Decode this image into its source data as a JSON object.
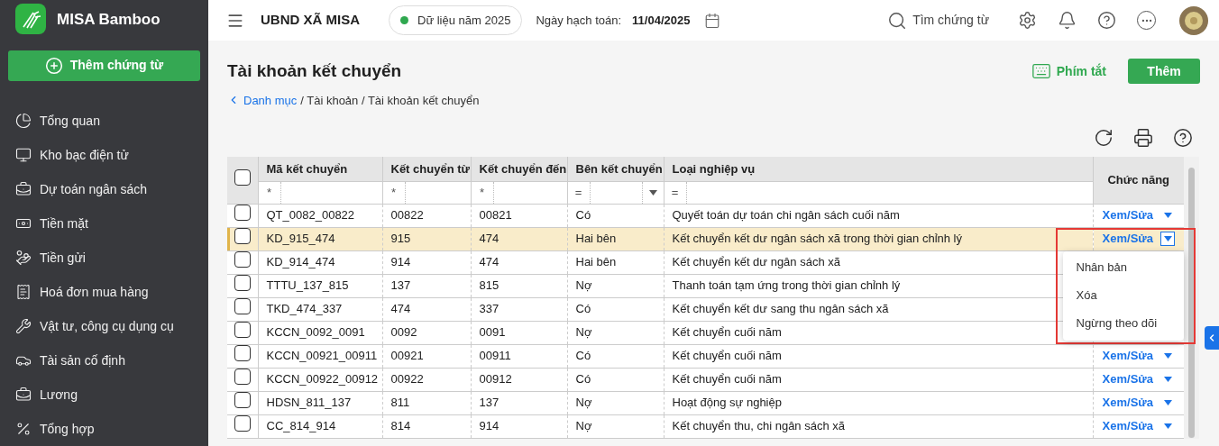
{
  "sidebar": {
    "logo": "MISA Bamboo",
    "add_button": "Thêm chứng từ",
    "items": [
      {
        "label": "Tổng quan"
      },
      {
        "label": "Kho bạc điện tử"
      },
      {
        "label": "Dự toán ngân sách"
      },
      {
        "label": "Tiền mặt"
      },
      {
        "label": "Tiền gửi"
      },
      {
        "label": "Hoá đơn mua hàng"
      },
      {
        "label": "Vật tư, công cụ dụng cụ"
      },
      {
        "label": "Tài sản cố định"
      },
      {
        "label": "Lương"
      },
      {
        "label": "Tổng hợp"
      }
    ]
  },
  "topbar": {
    "org": "UBND XÃ MISA",
    "data_year": "Dữ liệu năm 2025",
    "date_label": "Ngày hạch toán:",
    "date": "11/04/2025",
    "search": "Tìm chứng từ"
  },
  "page": {
    "title": "Tài khoản kết chuyển",
    "breadcrumb_link": "Danh mục",
    "breadcrumb_rest": "/ Tài khoản / Tài khoản kết chuyển",
    "shortcut": "Phím tắt",
    "add": "Thêm"
  },
  "table": {
    "header_checked": false,
    "columns": [
      {
        "label": "Mã kết chuyển",
        "filter_op": "*",
        "filter_dropdown": false
      },
      {
        "label": "Kết chuyển từ",
        "filter_op": "*",
        "filter_dropdown": false
      },
      {
        "label": "Kết chuyển đến",
        "filter_op": "*",
        "filter_dropdown": false
      },
      {
        "label": "Bên kết chuyển",
        "filter_op": "=",
        "filter_dropdown": true
      },
      {
        "label": "Loại nghiệp vụ",
        "filter_op": "=",
        "filter_dropdown": false
      }
    ],
    "action_column": "Chức năng",
    "rows": [
      {
        "cells": [
          "QT_0082_00822",
          "00822",
          "00821",
          "Có",
          "Quyết toán dự toán chi ngân sách cuối năm"
        ],
        "action": "Xem/Sửa",
        "selected": false,
        "checked": false,
        "menu_open": false
      },
      {
        "cells": [
          "KD_915_474",
          "915",
          "474",
          "Hai bên",
          "Kết chuyển kết dư ngân sách xã trong thời gian chỉnh lý"
        ],
        "action": "Xem/Sửa",
        "selected": true,
        "checked": false,
        "menu_open": true
      },
      {
        "cells": [
          "KD_914_474",
          "914",
          "474",
          "Hai bên",
          "Kết chuyển kết dư ngân sách xã"
        ],
        "selected": false,
        "checked": false,
        "menu_open": false
      },
      {
        "cells": [
          "TTTU_137_815",
          "137",
          "815",
          "Nợ",
          "Thanh toán tạm ứng trong thời gian chỉnh lý"
        ],
        "selected": false,
        "checked": false,
        "menu_open": false
      },
      {
        "cells": [
          "TKD_474_337",
          "474",
          "337",
          "Có",
          "Kết chuyển kết dư sang thu ngân sách xã"
        ],
        "selected": false,
        "checked": false,
        "menu_open": false
      },
      {
        "cells": [
          "KCCN_0092_0091",
          "0092",
          "0091",
          "Nợ",
          "Kết chuyển cuối năm"
        ],
        "selected": false,
        "checked": false,
        "menu_open": false
      },
      {
        "cells": [
          "KCCN_00921_00911",
          "00921",
          "00911",
          "Có",
          "Kết chuyển cuối năm"
        ],
        "action": "Xem/Sửa",
        "selected": false,
        "checked": false,
        "menu_open": false
      },
      {
        "cells": [
          "KCCN_00922_00912",
          "00922",
          "00912",
          "Có",
          "Kết chuyển cuối năm"
        ],
        "action": "Xem/Sửa",
        "selected": false,
        "checked": false,
        "menu_open": false
      },
      {
        "cells": [
          "HDSN_811_137",
          "811",
          "137",
          "Nợ",
          "Hoạt động sự nghiệp"
        ],
        "action": "Xem/Sửa",
        "selected": false,
        "checked": false,
        "menu_open": false
      },
      {
        "cells": [
          "CC_814_914",
          "814",
          "914",
          "Nợ",
          "Kết chuyển thu, chi ngân sách xã"
        ],
        "action": "Xem/Sửa",
        "selected": false,
        "checked": false,
        "menu_open": false
      }
    ],
    "row_menu": [
      "Nhân bản",
      "Xóa",
      "Ngừng theo dõi"
    ]
  }
}
